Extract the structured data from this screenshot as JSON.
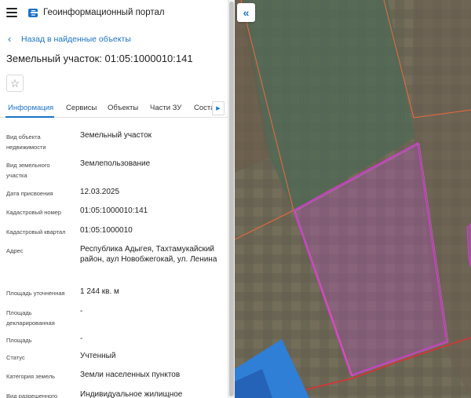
{
  "header": {
    "title": "Геоинформационный портал",
    "menu_icon": "hamburger-icon",
    "logo_icon": "portal-logo-icon"
  },
  "nav": {
    "back_label": "Назад в найденные объекты"
  },
  "object": {
    "title": "Земельный участок: 01:05:1000010:141"
  },
  "tabs": [
    {
      "label": "Информация",
      "active": true
    },
    {
      "label": "Сервисы",
      "active": false
    },
    {
      "label": "Объекты",
      "active": false
    },
    {
      "label": "Части ЗУ",
      "active": false
    },
    {
      "label": "Состав",
      "active": false
    }
  ],
  "fields": [
    {
      "label": "Вид объекта недвижимости",
      "value": "Земельный участок"
    },
    {
      "label": "Вид земельного участка",
      "value": "Землепользование"
    },
    {
      "label": "Дата присвоения",
      "value": "12.03.2025"
    },
    {
      "label": "Кадастровый номер",
      "value": "01:05:1000010:141"
    },
    {
      "label": "Кадастровый квартал",
      "value": "01:05:1000010"
    },
    {
      "label": "Адрес",
      "value": "Республика Адыгея, Тахтамукайский район, аул Новобжегокай, ул. Ленина"
    },
    {
      "label": "Площадь уточненная",
      "value": "1 244 кв. м"
    },
    {
      "label": "Площадь декларированная",
      "value": "-"
    },
    {
      "label": "Площадь",
      "value": "-"
    },
    {
      "label": "Статус",
      "value": "Учтенный"
    },
    {
      "label": "Категория земель",
      "value": "Земли населенных пунктов"
    },
    {
      "label": "Вид разрешенного",
      "value": "Индивидуальное жилищное"
    }
  ],
  "colors": {
    "accent": "#1a73c8",
    "parcel_outline": "#d23cd2",
    "boundary_line": "#f06a3a",
    "water": "#2f7fd6"
  }
}
